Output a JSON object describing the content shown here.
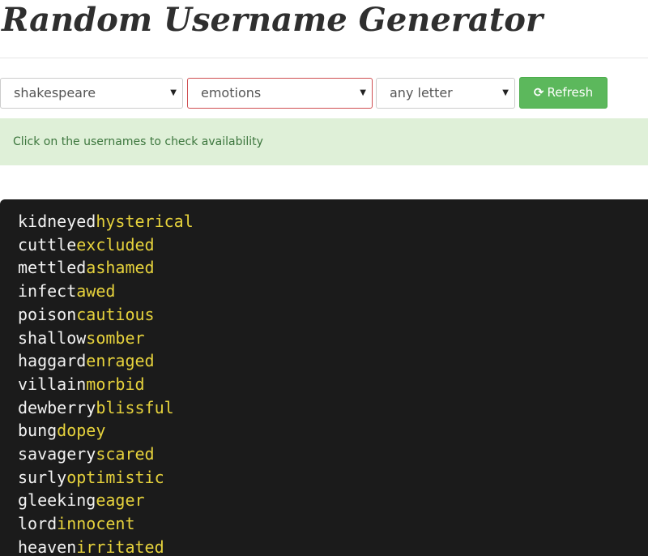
{
  "header": {
    "title": "Random Username Generator"
  },
  "controls": {
    "source_select": "shakespeare",
    "category_select": "emotions",
    "letter_select": "any letter",
    "refresh_label": "Refresh"
  },
  "alert": {
    "text": "Click on the usernames to check availability"
  },
  "colors": {
    "primary_word": "#f2f2f2",
    "secondary_word": "#e6d23c",
    "refresh_button": "#5cb85c",
    "alert_background": "#dff0d8"
  },
  "usernames": [
    {
      "first": "kidneyed",
      "second": "hysterical"
    },
    {
      "first": "cuttle",
      "second": "excluded"
    },
    {
      "first": "mettled",
      "second": "ashamed"
    },
    {
      "first": "infect",
      "second": "awed"
    },
    {
      "first": "poison",
      "second": "cautious"
    },
    {
      "first": "shallow",
      "second": "somber"
    },
    {
      "first": "haggard",
      "second": "enraged"
    },
    {
      "first": "villain",
      "second": "morbid"
    },
    {
      "first": "dewberry",
      "second": "blissful"
    },
    {
      "first": "bung",
      "second": "dopey"
    },
    {
      "first": "savagery",
      "second": "scared"
    },
    {
      "first": "surly",
      "second": "optimistic"
    },
    {
      "first": "gleeking",
      "second": "eager"
    },
    {
      "first": "lord",
      "second": "innocent"
    },
    {
      "first": "heaven",
      "second": "irritated"
    }
  ]
}
